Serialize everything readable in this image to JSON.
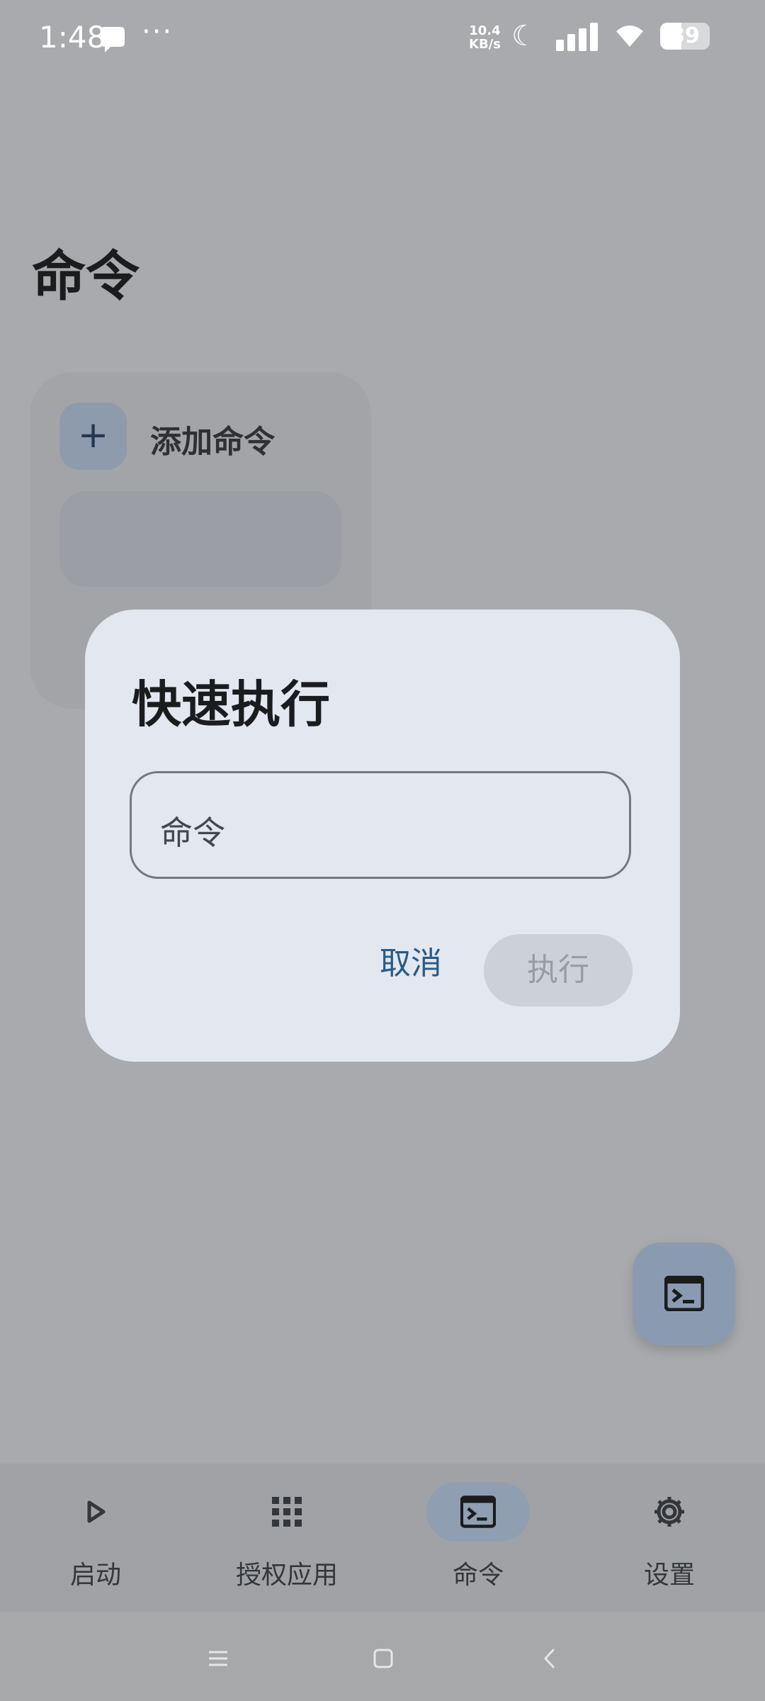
{
  "status_bar": {
    "time": "1:48",
    "more_indicator": "···",
    "net_speed_value": "10.4",
    "net_speed_unit": "KB/s",
    "battery": "39",
    "icons": [
      "message-icon",
      "moon-icon",
      "signal-icon",
      "wifi-icon",
      "battery-icon"
    ]
  },
  "page": {
    "title": "命令",
    "add_command_label": "添加命令"
  },
  "dialog": {
    "title": "快速执行",
    "input_placeholder": "命令",
    "cancel_label": "取消",
    "execute_label": "执行"
  },
  "fab": {
    "icon": "terminal-icon"
  },
  "bottom_nav": {
    "items": [
      {
        "label": "启动",
        "icon": "play-icon",
        "active": false
      },
      {
        "label": "授权应用",
        "icon": "apps-grid-icon",
        "active": false
      },
      {
        "label": "命令",
        "icon": "terminal-icon",
        "active": true
      },
      {
        "label": "设置",
        "icon": "gear-icon",
        "active": false
      }
    ]
  },
  "system_nav": {
    "icons": [
      "menu-icon",
      "home-icon",
      "back-icon"
    ]
  },
  "colors": {
    "scrim_background": "#a9aaad",
    "dialog_background": "#e2e7f0",
    "accent": "#2a5b85",
    "disabled_button": "#ccd0d8"
  }
}
